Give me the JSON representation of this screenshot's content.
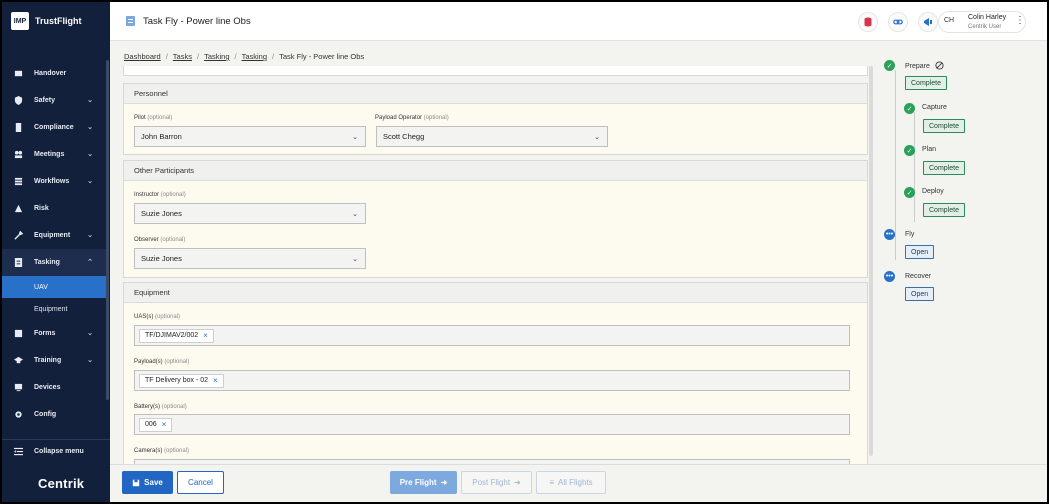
{
  "app": {
    "logo_mark": "IMP",
    "name": "TrustFlight",
    "footer_brand": "Centrik"
  },
  "sidebar": {
    "items": [
      {
        "label": "Handover",
        "icon": "handover-icon",
        "has_chevron": false
      },
      {
        "label": "Safety",
        "icon": "shield-icon",
        "has_chevron": true
      },
      {
        "label": "Compliance",
        "icon": "compliance-icon",
        "has_chevron": true
      },
      {
        "label": "Meetings",
        "icon": "meetings-icon",
        "has_chevron": true
      },
      {
        "label": "Workflows",
        "icon": "workflows-icon",
        "has_chevron": true
      },
      {
        "label": "Risk",
        "icon": "warning-icon",
        "has_chevron": false
      },
      {
        "label": "Equipment",
        "icon": "wrench-icon",
        "has_chevron": true
      },
      {
        "label": "Tasking",
        "icon": "tasking-icon",
        "has_chevron": true,
        "expanded": true
      }
    ],
    "sub_items": [
      {
        "label": "UAV",
        "active": true
      },
      {
        "label": "Equipment",
        "active": false
      }
    ],
    "items_after": [
      {
        "label": "Forms",
        "icon": "forms-icon",
        "has_chevron": true
      },
      {
        "label": "Training",
        "icon": "graduation-cap-icon",
        "has_chevron": true
      },
      {
        "label": "Devices",
        "icon": "devices-icon",
        "has_chevron": false
      },
      {
        "label": "Config",
        "icon": "config-icon",
        "has_chevron": false
      }
    ],
    "collapse_label": "Collapse menu"
  },
  "header": {
    "title": "Task Fly - Power line Obs",
    "user": {
      "initials": "CH",
      "name": "Colin Harley",
      "role": "Centrik User"
    }
  },
  "breadcrumb": [
    {
      "label": "Dashboard",
      "link": true
    },
    {
      "label": "Tasks",
      "link": true
    },
    {
      "label": "Tasking",
      "link": true
    },
    {
      "label": "Tasking",
      "link": true
    },
    {
      "label": "Task Fly - Power line Obs",
      "link": false
    }
  ],
  "personnel": {
    "heading": "Personnel",
    "pilot": {
      "label": "Pilot",
      "optional": "(optional)",
      "value": "John Barron"
    },
    "payload_operator": {
      "label": "Payload Operator",
      "optional": "(optional)",
      "value": "Scott Chegg"
    }
  },
  "participants": {
    "heading": "Other Participants",
    "instructor": {
      "label": "Instructor",
      "optional": "(optional)",
      "value": "Suzie Jones"
    },
    "observer": {
      "label": "Observer",
      "optional": "(optional)",
      "value": "Suzie Jones"
    }
  },
  "equipment": {
    "heading": "Equipment",
    "uas": {
      "label": "UAS(s)",
      "optional": "(optional)",
      "chip": "TF/DJIMAV2/002"
    },
    "payloads": {
      "label": "Payload(s)",
      "optional": "(optional)",
      "chip": "TF Delivery box - 02"
    },
    "batteries": {
      "label": "Battery(s)",
      "optional": "(optional)",
      "chip": "006"
    },
    "cameras": {
      "label": "Camera(s)",
      "optional": "(optional)"
    }
  },
  "stepper": {
    "steps": [
      {
        "label": "Prepare",
        "button": "Complete",
        "status": "done"
      },
      {
        "label": "Capture",
        "button": "Complete",
        "status": "done"
      },
      {
        "label": "Plan",
        "button": "Complete",
        "status": "done"
      },
      {
        "label": "Deploy",
        "button": "Complete",
        "status": "done"
      },
      {
        "label": "Fly",
        "button": "Open",
        "status": "open"
      },
      {
        "label": "Recover",
        "button": "Open",
        "status": "open"
      }
    ]
  },
  "footer": {
    "save": "Save",
    "cancel": "Cancel",
    "pre_flight": "Pre Flight",
    "post_flight": "Post Flight",
    "all_flights": "All Flights"
  },
  "colors": {
    "sidebar": "#13203b",
    "accent": "#2266c4",
    "success": "#2aa05a"
  }
}
